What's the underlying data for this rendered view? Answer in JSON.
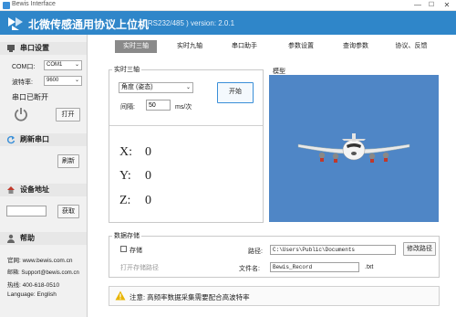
{
  "window": {
    "title": "Bewis Interface",
    "minimize": "—",
    "maximize": "☐",
    "close": "✕"
  },
  "header": {
    "title": "北微传感通用协议上位机",
    "version": "( RS232/485 ) version: 2.0.1"
  },
  "sidebar": {
    "serial": {
      "title": "串口设置",
      "com_label": "COM口:",
      "com_value": "COM1",
      "baud_label": "波特率:",
      "baud_value": "9600",
      "status": "串口已断开",
      "open_button": "打开"
    },
    "refresh": {
      "title": "刷新串口",
      "button": "刷新"
    },
    "device": {
      "title": "设备地址",
      "address_value": "",
      "get_button": "获取"
    },
    "help": {
      "title": "帮助",
      "website": "官网: www.bewis.com.cn",
      "email": "邮箱: Support@bewis.com.cn",
      "hotline": "热线: 400-618-0510",
      "language": "Language: English"
    }
  },
  "tabs": [
    "实时三轴",
    "实时九轴",
    "串口助手",
    "参数设置",
    "查询参数",
    "协议、反馈"
  ],
  "active_tab": 0,
  "realtime": {
    "group_title": "实时三轴",
    "mode_value": "角度 (姿态)",
    "interval_label": "间隔:",
    "interval_value": "50",
    "interval_unit": "ms/次",
    "start_button": "开始",
    "x_label": "X:",
    "x_value": "0",
    "y_label": "Y:",
    "y_value": "0",
    "z_label": "Z:",
    "z_value": "0"
  },
  "model": {
    "title": "模型",
    "background_color": "#4f86c6"
  },
  "storage": {
    "group_title": "数据存储",
    "store_checkbox": "存储",
    "store_checked": false,
    "open_path": "打开存储路径",
    "path_label": "路径:",
    "path_value": "C:\\Users\\Public\\Documents",
    "change_path_button": "修改路径",
    "filename_label": "文件名:",
    "filename_value": "Bewis_Record",
    "file_ext": ".txt"
  },
  "notice": {
    "text": "注意: 高频率数据采集需要配合高波特率"
  },
  "colors": {
    "header": "#2f86c9",
    "sidebar": "#f1f1f1",
    "active_tab": "#8a8a8a",
    "warning": "#e8b400"
  }
}
